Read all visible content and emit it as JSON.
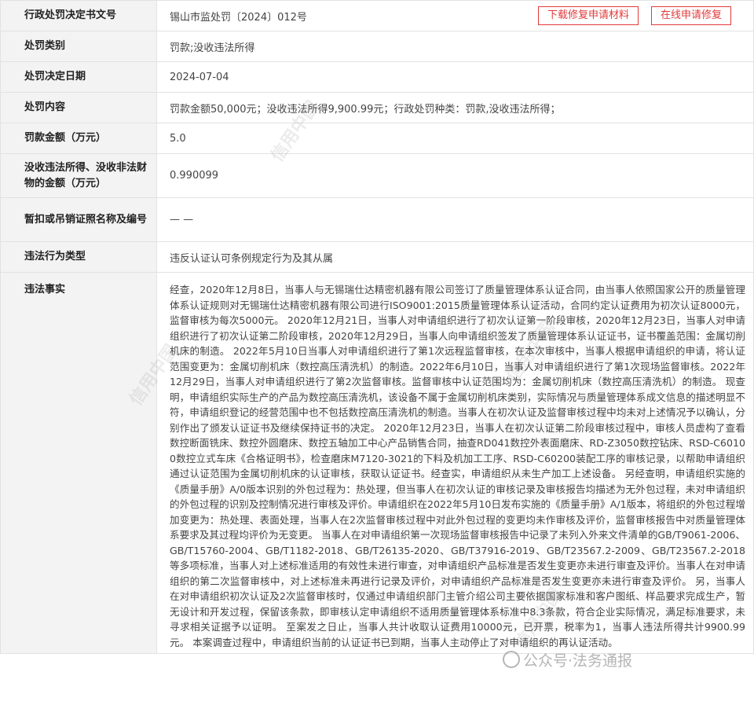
{
  "document_number": {
    "label": "行政处罚决定书文号",
    "value": "锡山市监处罚〔2024〕012号",
    "download_button": "下载修复申请材料",
    "apply_button": "在线申请修复"
  },
  "rows": {
    "penalty_type": {
      "label": "处罚类别",
      "value": "罚款;没收违法所得"
    },
    "decision_date": {
      "label": "处罚决定日期",
      "value": "2024-07-04"
    },
    "penalty_content": {
      "label": "处罚内容",
      "value": "罚款金额50,000元；没收违法所得9,900.99元；行政处罚种类：罚款,没收违法所得；"
    },
    "fine_amount": {
      "label": "罚款金额（万元）",
      "value": "5.0"
    },
    "confiscation_amount": {
      "label": "没收违法所得、没收非法财物的金额（万元）",
      "value": "0.990099"
    },
    "license_revoked": {
      "label": "暂扣或吊销证照名称及编号",
      "value": "— —"
    },
    "violation_type": {
      "label": "违法行为类型",
      "value": "违反认证认可条例规定行为及其从属"
    },
    "violation_facts": {
      "label": "违法事实",
      "value": "经查，2020年12月8日，当事人与无锡瑞仕达精密机器有限公司签订了质量管理体系认证合同，由当事人依照国家公开的质量管理体系认证规则对无锡瑞仕达精密机器有限公司进行ISO9001:2015质量管理体系认证活动，合同约定认证费用为初次认证8000元，监督审核为每次5000元。 2020年12月21日，当事人对申请组织进行了初次认证第一阶段审核，2020年12月23日，当事人对申请组织进行了初次认证第二阶段审核，2020年12月29日，当事人向申请组织签发了质量管理体系认证证书，证书覆盖范围：金属切削机床的制造。 2022年5月10日当事人对申请组织进行了第1次远程监督审核，在本次审核中，当事人根据申请组织的申请，将认证范围变更为：金属切削机床（数控高压清洗机）的制造。2022年6月10日，当事人对申请组织进行了第1次现场监督审核。2022年12月29日，当事人对申请组织进行了第2次监督审核。监督审核中认证范围均为：金属切削机床（数控高压清洗机）的制造。 现查明，申请组织实际生产的产品为数控高压清洗机，该设备不属于金属切削机床类别，实际情况与质量管理体系成文信息的描述明显不符，申请组织登记的经营范围中也不包括数控高压清洗机的制造。当事人在初次认证及监督审核过程中均未对上述情况予以确认，分别作出了颁发认证证书及继续保持证书的决定。 2020年12月23日，当事人在初次认证第二阶段审核过程中，审核人员虚构了查看数控断面铣床、数控外圆磨床、数控五轴加工中心产品销售合同，抽查RD041数控外表面磨床、RD-Z3050数控钻床、RSD-C60100数控立式车床《合格证明书》，检查磨床M7120-3021的下料及机加工工序、RSD-C60200装配工序的审核记录，以帮助申请组织通过认证范围为金属切削机床的认证审核，获取认证证书。经查实，申请组织从未生产加工上述设备。 另经查明，申请组织实施的《质量手册》A/0版本识别的外包过程为：热处理，但当事人在初次认证的审核记录及审核报告均描述为无外包过程，未对申请组织的外包过程的识别及控制情况进行审核及评价。申请组织在2022年5月10日发布实施的《质量手册》A/1版本，将组织的外包过程增加变更为：热处理、表面处理，当事人在2次监督审核过程中对此外包过程的变更均未作审核及评价，监督审核报告中对质量管理体系要求及其过程均评价为无变更。 当事人在对申请组织第一次现场监督审核报告中记录了未列入外来文件清单的GB/T9061-2006、GB/T15760-2004、GB/T1182-2018、GB/T26135-2020、GB/T37916-2019、GB/T23567.2-2009、GB/T23567.2-2018等多项标准，当事人对上述标准适用的有效性未进行审查，对申请组织产品标准是否发生变更亦未进行审查及评价。当事人在对申请组织的第二次监督审核中，对上述标准未再进行记录及评价，对申请组织产品标准是否发生变更亦未进行审查及评价。 另，当事人在对申请组织初次认证及2次监督审核时，仅通过申请组织部门主管介绍公司主要依据国家标准和客户图纸、样品要求完成生产，暂无设计和开发过程，保留该条款，即审核认定申请组织不适用质量管理体系标准中8.3条款，符合企业实际情况，满足标准要求，未寻求相关证据予以证明。 至案发之日止，当事人共计收取认证费用10000元，已开票，税率为1，当事人违法所得共计9900.99元。 本案调查过程中，申请组织当前的认证证书已到期，当事人主动停止了对申请组织的再认证活动。"
    }
  },
  "watermark_text": "信用中国",
  "brand_overlay": "公众号·法务通报"
}
